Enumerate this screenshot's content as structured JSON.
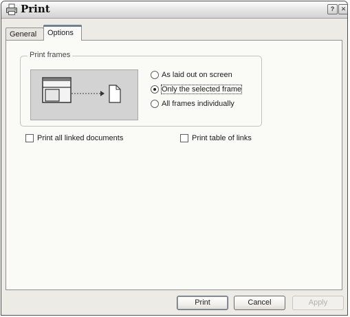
{
  "window": {
    "title": "Print"
  },
  "titlebar": {
    "help_label": "?",
    "close_label": "✕"
  },
  "tabs": [
    {
      "label": "General",
      "active": false
    },
    {
      "label": "Options",
      "active": true
    }
  ],
  "print_frames": {
    "legend": "Print frames",
    "options": [
      {
        "label": "As laid out on screen",
        "selected": false
      },
      {
        "label": "Only the selected frame",
        "selected": true
      },
      {
        "label": "All frames individually",
        "selected": false
      }
    ]
  },
  "checkboxes": {
    "linked_documents": {
      "label": "Print all linked documents",
      "checked": false
    },
    "table_of_links": {
      "label": "Print table of links",
      "checked": false
    }
  },
  "buttons": {
    "print": "Print",
    "cancel": "Cancel",
    "apply": "Apply"
  },
  "icons": {
    "app": "printer-icon",
    "help": "help-icon",
    "close": "close-icon"
  }
}
